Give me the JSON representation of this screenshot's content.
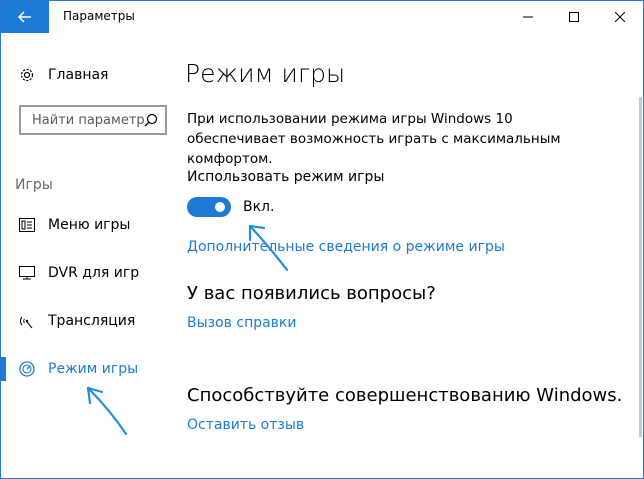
{
  "window": {
    "title": "Параметры",
    "accent": "#1e7bd4"
  },
  "sidebar": {
    "home_label": "Главная",
    "search_placeholder": "Найти параметр",
    "section_label": "Игры",
    "items": [
      {
        "label": "Меню игры",
        "icon": "game-bar-icon"
      },
      {
        "label": "DVR для игр",
        "icon": "dvr-icon"
      },
      {
        "label": "Трансляция",
        "icon": "broadcast-icon"
      },
      {
        "label": "Режим игры",
        "icon": "game-mode-icon",
        "active": true
      }
    ]
  },
  "main": {
    "title": "Режим игры",
    "description": "При использовании режима игры Windows 10 обеспечивает возможность играть с максимальным комфортом.",
    "toggle_label": "Использовать режим игры",
    "toggle_state": "Вкл.",
    "toggle_on": true,
    "more_info_link": "Дополнительные сведения о режиме игры",
    "questions_heading": "У вас появились вопросы?",
    "help_link": "Вызов справки",
    "contribute_heading": "Способствуйте совершенствованию Windows.",
    "feedback_link": "Оставить отзыв"
  }
}
